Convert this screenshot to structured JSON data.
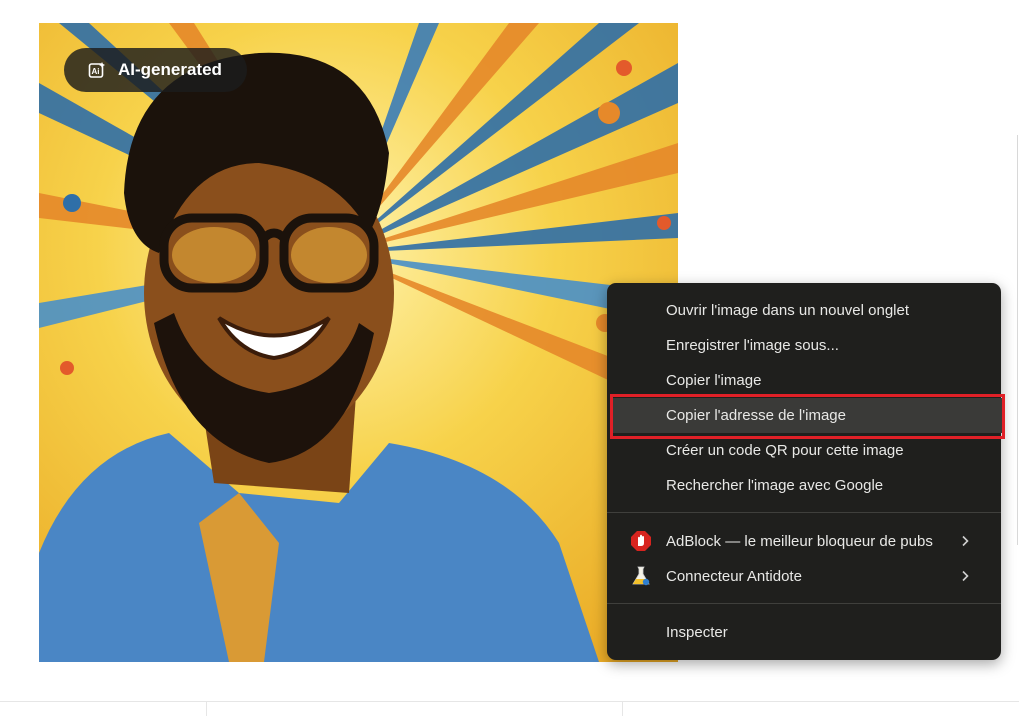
{
  "badge": {
    "label": "AI-generated"
  },
  "context_menu": {
    "items": [
      {
        "label": "Ouvrir l'image dans un nouvel onglet"
      },
      {
        "label": "Enregistrer l'image sous..."
      },
      {
        "label": "Copier l'image"
      },
      {
        "label": "Copier l'adresse de l'image"
      },
      {
        "label": "Créer un code QR pour cette image"
      },
      {
        "label": "Rechercher l'image avec Google"
      }
    ],
    "extensions": [
      {
        "label": "AdBlock — le meilleur bloqueur de pubs",
        "icon": "adblock-hand-icon"
      },
      {
        "label": "Connecteur Antidote",
        "icon": "antidote-flask-icon"
      }
    ],
    "inspect": {
      "label": "Inspecter"
    }
  },
  "colors": {
    "menu_bg": "#1f1f1d",
    "menu_hover": "#3a3a38",
    "highlight_border": "#e02027",
    "image_yellow": "#f3c12b",
    "shirt_blue": "#4a86c5"
  }
}
